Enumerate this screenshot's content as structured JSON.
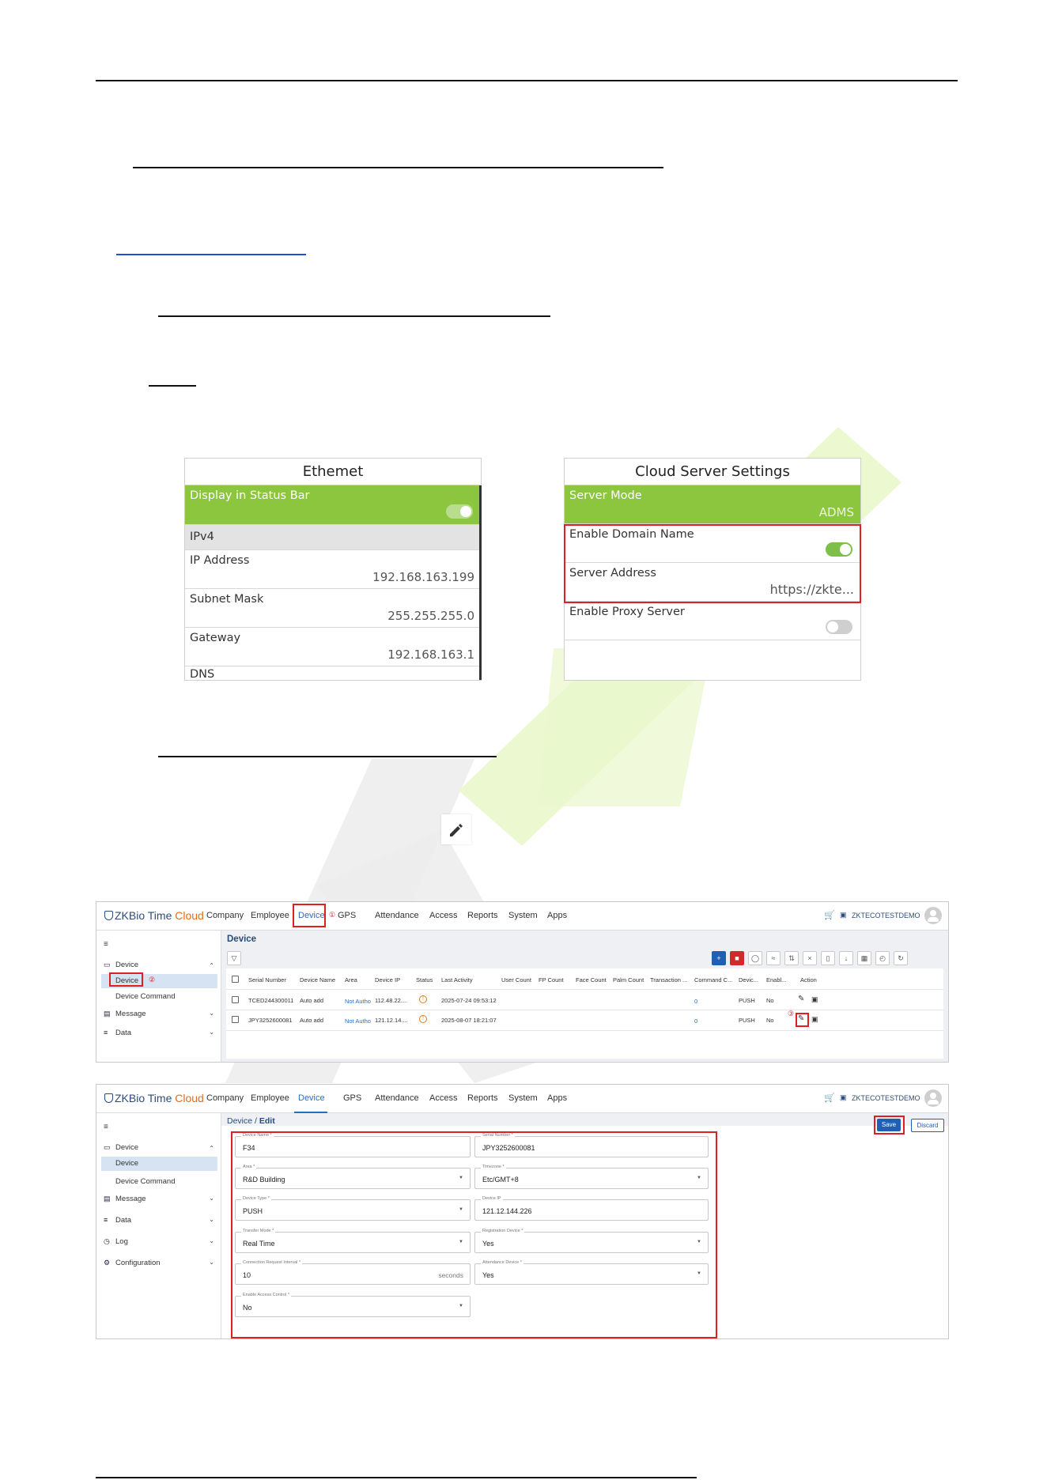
{
  "ethernet_panel": {
    "title": "Ethemet",
    "rows": [
      {
        "label": "Display in Status Bar",
        "toggle": "on"
      },
      {
        "label": "IPv4"
      },
      {
        "label": "IP Address",
        "value": "192.168.163.199"
      },
      {
        "label": "Subnet Mask",
        "value": "255.255.255.0"
      },
      {
        "label": "Gateway",
        "value": "192.168.163.1"
      },
      {
        "label": "DNS"
      }
    ]
  },
  "cloud_panel": {
    "title": "Cloud Server Settings",
    "rows": [
      {
        "label": "Server Mode",
        "value": "ADMS"
      },
      {
        "label": "Enable Domain Name",
        "toggle": "on"
      },
      {
        "label": "Server Address",
        "value": "https://zkte..."
      },
      {
        "label": "Enable Proxy Server",
        "toggle": "off"
      }
    ]
  },
  "app": {
    "logo_main": "ZKBio Time",
    "logo_accent": "Cloud",
    "nav": [
      "Company",
      "Employee",
      "Device",
      "GPS",
      "Attendance",
      "Access",
      "Reports",
      "System",
      "Apps"
    ],
    "company_name": "ZKTECOTESTDEMO",
    "colors": {
      "accent": "#2a6ebb",
      "brand_orange": "#e46c1a",
      "annotation_red": "#e02020"
    }
  },
  "list_screen": {
    "step_marks": [
      "①",
      "②",
      "③"
    ],
    "sidebar": {
      "device": "Device",
      "device_sub": "Device",
      "device_command": "Device Command",
      "message": "Message",
      "data": "Data"
    },
    "page_title": "Device",
    "columns": [
      "Serial Number",
      "Device Name",
      "Area",
      "Device IP",
      "Status",
      "Last Activity",
      "User Count",
      "FP Count",
      "Face Count",
      "Palm Count",
      "Transaction ...",
      "Command C...",
      "Devic...",
      "Enabl...",
      "Action"
    ],
    "rows": [
      {
        "serial": "TCED244300011",
        "name": "Auto add",
        "area": "Not Autho",
        "ip": "112.48.22....",
        "last": "2025-07-24 09:53:12",
        "cmd": "0",
        "dev": "PUSH",
        "enabl": "No"
      },
      {
        "serial": "JPY3252600081",
        "name": "Auto add",
        "area": "Not Autho",
        "ip": "121.12.14....",
        "last": "2025-08-07 18:21:07",
        "cmd": "0",
        "dev": "PUSH",
        "enabl": "No"
      }
    ]
  },
  "edit_screen": {
    "sidebar": {
      "device": "Device",
      "device_sub": "Device",
      "device_command": "Device Command",
      "message": "Message",
      "data": "Data",
      "log": "Log",
      "configuration": "Configuration"
    },
    "breadcrumb_root": "Device",
    "breadcrumb_sep": "/",
    "breadcrumb_current": "Edit",
    "save": "Save",
    "discard": "Discard",
    "fields": {
      "device_name": {
        "label": "Device Name *",
        "value": "F34"
      },
      "serial_number": {
        "label": "Serial Number *",
        "value": "JPY3252600081"
      },
      "area": {
        "label": "Area *",
        "value": "R&D Building"
      },
      "timezone": {
        "label": "Timezone *",
        "value": "Etc/GMT+8"
      },
      "device_type": {
        "label": "Device Type *",
        "value": "PUSH"
      },
      "device_ip": {
        "label": "Device IP",
        "value": "121.12.144.226"
      },
      "transfer_mode": {
        "label": "Transfer Mode *",
        "value": "Real Time"
      },
      "registration_device": {
        "label": "Registration Device *",
        "value": "Yes"
      },
      "connection_interval": {
        "label": "Connection Request Interval *",
        "value": "10",
        "suffix": "seconds"
      },
      "attendance_device": {
        "label": "Attendance Device *",
        "value": "Yes"
      },
      "enable_access_control": {
        "label": "Enable Access Control *",
        "value": "No"
      }
    }
  }
}
